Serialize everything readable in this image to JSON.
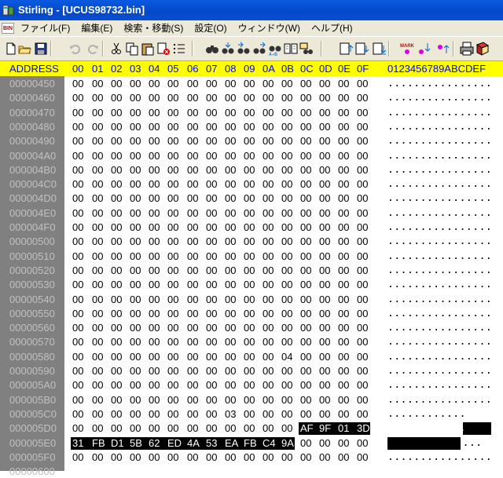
{
  "window": {
    "title": "Stirling - [UCUS98732.bin]"
  },
  "menu": {
    "bin_icon": "BIN",
    "items": [
      "ファイル(F)",
      "編集(E)",
      "検索・移動(S)",
      "設定(O)",
      "ウィンドウ(W)",
      "ヘルプ(H)"
    ]
  },
  "toolbar": {
    "buttons": [
      {
        "name": "new-file-icon"
      },
      {
        "name": "open-folder-icon"
      },
      {
        "name": "save-icon"
      },
      {
        "name": "undo-icon"
      },
      {
        "name": "redo-icon"
      },
      {
        "name": "cut-icon"
      },
      {
        "name": "copy-icon"
      },
      {
        "name": "paste-icon"
      },
      {
        "name": "delete-icon"
      },
      {
        "name": "list-icon"
      },
      {
        "name": "find-icon"
      },
      {
        "name": "find-next-icon"
      },
      {
        "name": "find-prev-icon"
      },
      {
        "name": "find-hex-icon"
      },
      {
        "name": "replace-icon"
      },
      {
        "name": "compare-icon"
      },
      {
        "name": "jump-icon"
      },
      {
        "name": "page-up-icon"
      },
      {
        "name": "page-down-icon"
      },
      {
        "name": "page-end-icon"
      },
      {
        "name": "mark-icon"
      },
      {
        "name": "mark-next-icon"
      },
      {
        "name": "mark-prev-icon"
      },
      {
        "name": "print-icon"
      },
      {
        "name": "book-icon"
      }
    ],
    "mark_label": "MARK"
  },
  "header": {
    "address": "ADDRESS",
    "columns": [
      "00",
      "01",
      "02",
      "03",
      "04",
      "05",
      "06",
      "07",
      "08",
      "09",
      "0A",
      "0B",
      "0C",
      "0D",
      "0E",
      "0F"
    ],
    "ascii": "0123456789ABCDEF"
  },
  "rows": [
    {
      "addr": "00000450",
      "bytes": [
        "00",
        "00",
        "00",
        "00",
        "00",
        "00",
        "00",
        "00",
        "00",
        "00",
        "00",
        "00",
        "00",
        "00",
        "00",
        "00"
      ],
      "ascii": "................"
    },
    {
      "addr": "00000460",
      "bytes": [
        "00",
        "00",
        "00",
        "00",
        "00",
        "00",
        "00",
        "00",
        "00",
        "00",
        "00",
        "00",
        "00",
        "00",
        "00",
        "00"
      ],
      "ascii": "................"
    },
    {
      "addr": "00000470",
      "bytes": [
        "00",
        "00",
        "00",
        "00",
        "00",
        "00",
        "00",
        "00",
        "00",
        "00",
        "00",
        "00",
        "00",
        "00",
        "00",
        "00"
      ],
      "ascii": "................"
    },
    {
      "addr": "00000480",
      "bytes": [
        "00",
        "00",
        "00",
        "00",
        "00",
        "00",
        "00",
        "00",
        "00",
        "00",
        "00",
        "00",
        "00",
        "00",
        "00",
        "00"
      ],
      "ascii": "................"
    },
    {
      "addr": "00000490",
      "bytes": [
        "00",
        "00",
        "00",
        "00",
        "00",
        "00",
        "00",
        "00",
        "00",
        "00",
        "00",
        "00",
        "00",
        "00",
        "00",
        "00"
      ],
      "ascii": "................"
    },
    {
      "addr": "000004A0",
      "bytes": [
        "00",
        "00",
        "00",
        "00",
        "00",
        "00",
        "00",
        "00",
        "00",
        "00",
        "00",
        "00",
        "00",
        "00",
        "00",
        "00"
      ],
      "ascii": "................"
    },
    {
      "addr": "000004B0",
      "bytes": [
        "00",
        "00",
        "00",
        "00",
        "00",
        "00",
        "00",
        "00",
        "00",
        "00",
        "00",
        "00",
        "00",
        "00",
        "00",
        "00"
      ],
      "ascii": "................"
    },
    {
      "addr": "000004C0",
      "bytes": [
        "00",
        "00",
        "00",
        "00",
        "00",
        "00",
        "00",
        "00",
        "00",
        "00",
        "00",
        "00",
        "00",
        "00",
        "00",
        "00"
      ],
      "ascii": "................"
    },
    {
      "addr": "000004D0",
      "bytes": [
        "00",
        "00",
        "00",
        "00",
        "00",
        "00",
        "00",
        "00",
        "00",
        "00",
        "00",
        "00",
        "00",
        "00",
        "00",
        "00"
      ],
      "ascii": "................"
    },
    {
      "addr": "000004E0",
      "bytes": [
        "00",
        "00",
        "00",
        "00",
        "00",
        "00",
        "00",
        "00",
        "00",
        "00",
        "00",
        "00",
        "00",
        "00",
        "00",
        "00"
      ],
      "ascii": "................"
    },
    {
      "addr": "000004F0",
      "bytes": [
        "00",
        "00",
        "00",
        "00",
        "00",
        "00",
        "00",
        "00",
        "00",
        "00",
        "00",
        "00",
        "00",
        "00",
        "00",
        "00"
      ],
      "ascii": "................"
    },
    {
      "addr": "00000500",
      "bytes": [
        "00",
        "00",
        "00",
        "00",
        "00",
        "00",
        "00",
        "00",
        "00",
        "00",
        "00",
        "00",
        "00",
        "00",
        "00",
        "00"
      ],
      "ascii": "................"
    },
    {
      "addr": "00000510",
      "bytes": [
        "00",
        "00",
        "00",
        "00",
        "00",
        "00",
        "00",
        "00",
        "00",
        "00",
        "00",
        "00",
        "00",
        "00",
        "00",
        "00"
      ],
      "ascii": "................"
    },
    {
      "addr": "00000520",
      "bytes": [
        "00",
        "00",
        "00",
        "00",
        "00",
        "00",
        "00",
        "00",
        "00",
        "00",
        "00",
        "00",
        "00",
        "00",
        "00",
        "00"
      ],
      "ascii": "................"
    },
    {
      "addr": "00000530",
      "bytes": [
        "00",
        "00",
        "00",
        "00",
        "00",
        "00",
        "00",
        "00",
        "00",
        "00",
        "00",
        "00",
        "00",
        "00",
        "00",
        "00"
      ],
      "ascii": "................"
    },
    {
      "addr": "00000540",
      "bytes": [
        "00",
        "00",
        "00",
        "00",
        "00",
        "00",
        "00",
        "00",
        "00",
        "00",
        "00",
        "00",
        "00",
        "00",
        "00",
        "00"
      ],
      "ascii": "................"
    },
    {
      "addr": "00000550",
      "bytes": [
        "00",
        "00",
        "00",
        "00",
        "00",
        "00",
        "00",
        "00",
        "00",
        "00",
        "00",
        "00",
        "00",
        "00",
        "00",
        "00"
      ],
      "ascii": "................"
    },
    {
      "addr": "00000560",
      "bytes": [
        "00",
        "00",
        "00",
        "00",
        "00",
        "00",
        "00",
        "00",
        "00",
        "00",
        "00",
        "00",
        "00",
        "00",
        "00",
        "00"
      ],
      "ascii": "................"
    },
    {
      "addr": "00000570",
      "bytes": [
        "00",
        "00",
        "00",
        "00",
        "00",
        "00",
        "00",
        "00",
        "00",
        "00",
        "00",
        "00",
        "00",
        "00",
        "00",
        "00"
      ],
      "ascii": "................"
    },
    {
      "addr": "00000580",
      "bytes": [
        "00",
        "00",
        "00",
        "00",
        "00",
        "00",
        "00",
        "00",
        "00",
        "00",
        "00",
        "04",
        "00",
        "00",
        "00",
        "00"
      ],
      "ascii": "................"
    },
    {
      "addr": "00000590",
      "bytes": [
        "00",
        "00",
        "00",
        "00",
        "00",
        "00",
        "00",
        "00",
        "00",
        "00",
        "00",
        "00",
        "00",
        "00",
        "00",
        "00"
      ],
      "ascii": "................"
    },
    {
      "addr": "000005A0",
      "bytes": [
        "00",
        "00",
        "00",
        "00",
        "00",
        "00",
        "00",
        "00",
        "00",
        "00",
        "00",
        "00",
        "00",
        "00",
        "00",
        "00"
      ],
      "ascii": "................"
    },
    {
      "addr": "000005B0",
      "bytes": [
        "00",
        "00",
        "00",
        "00",
        "00",
        "00",
        "00",
        "00",
        "00",
        "00",
        "00",
        "00",
        "00",
        "00",
        "00",
        "00"
      ],
      "ascii": "................"
    },
    {
      "addr": "000005C0",
      "bytes": [
        "00",
        "00",
        "00",
        "00",
        "00",
        "00",
        "00",
        "00",
        "03",
        "00",
        "00",
        "00",
        "00",
        "00",
        "00",
        "00"
      ],
      "ascii": "................"
    },
    {
      "addr": "000005D0",
      "bytes": [
        "00",
        "00",
        "00",
        "00",
        "00",
        "00",
        "00",
        "00",
        "00",
        "00",
        "00",
        "00",
        "AF",
        "9F",
        "01",
        "3D"
      ],
      "ascii": "............ｯ..=",
      "sel_from": 12,
      "sel_to": 15
    },
    {
      "addr": "000005E0",
      "bytes": [
        "31",
        "FB",
        "D1",
        "5B",
        "62",
        "ED",
        "4A",
        "53",
        "EA",
        "FB",
        "C4",
        "9A",
        "00",
        "00",
        "00",
        "00"
      ],
      "ascii": "1鏡[b舁S・ト....",
      "sel_from": 0,
      "sel_to": 11
    },
    {
      "addr": "000005F0",
      "bytes": [
        "00",
        "00",
        "00",
        "00",
        "00",
        "00",
        "00",
        "00",
        "00",
        "00",
        "00",
        "00",
        "00",
        "00",
        "00",
        "00"
      ],
      "ascii": "................"
    },
    {
      "addr": "00000600",
      "bytes": [],
      "ascii": ""
    }
  ]
}
